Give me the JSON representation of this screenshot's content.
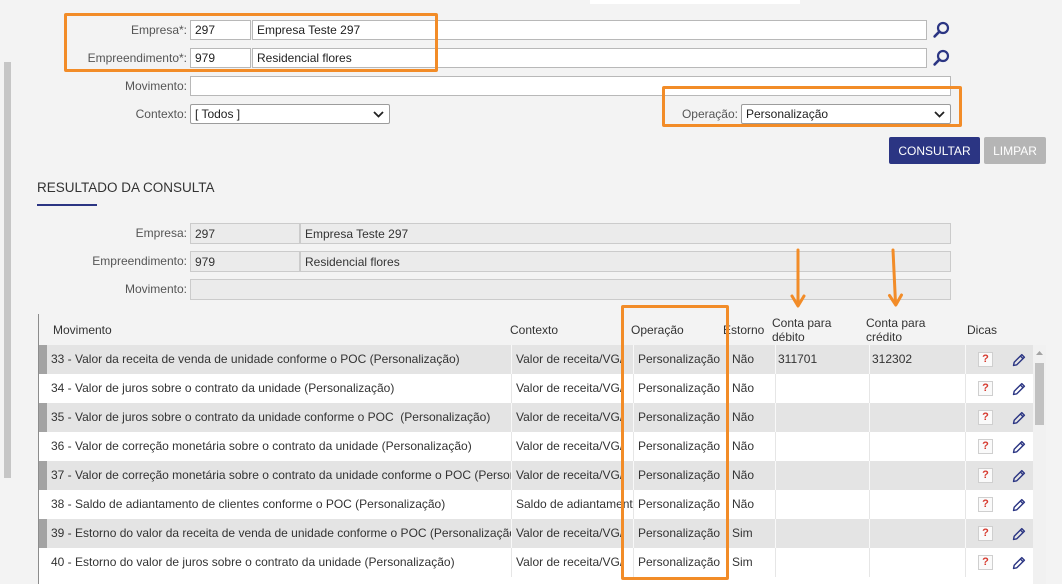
{
  "filters": {
    "empresa": {
      "label": "Empresa*:",
      "code": "297",
      "name": "Empresa Teste 297"
    },
    "empreendimento": {
      "label": "Empreendimento*:",
      "code": "979",
      "name": "Residencial flores"
    },
    "movimento": {
      "label": "Movimento:"
    },
    "contexto": {
      "label": "Contexto:",
      "selected": "[ Todos ]"
    },
    "operacao": {
      "label": "Operação:",
      "selected": "Personalização"
    }
  },
  "actions": {
    "consultar": "CONSULTAR",
    "limpar": "LIMPAR"
  },
  "result": {
    "heading": "RESULTADO DA CONSULTA",
    "empresa": {
      "label": "Empresa:",
      "code": "297",
      "name": "Empresa Teste 297"
    },
    "empreendimento": {
      "label": "Empreendimento:",
      "code": "979",
      "name": "Residencial flores"
    },
    "movimento": {
      "label": "Movimento:"
    }
  },
  "table": {
    "columns": {
      "movimento": "Movimento",
      "contexto": "Contexto",
      "operacao": "Operação",
      "estorno": "Estorno",
      "conta_debito": "Conta para débito",
      "conta_credito": "Conta para crédito",
      "dicas": "Dicas"
    },
    "help_glyph": "?",
    "rows": [
      {
        "movimento": "33 - Valor da receita de venda de unidade conforme o POC (Personalização)",
        "contexto": "Valor de receita/VG/",
        "operacao": "Personalização",
        "estorno": "Não",
        "conta_debito": "311701",
        "conta_credito": "312302"
      },
      {
        "movimento": "34 - Valor de juros sobre o contrato da unidade (Personalização)",
        "contexto": "Valor de receita/VG/",
        "operacao": "Personalização",
        "estorno": "Não"
      },
      {
        "movimento": "35 - Valor de juros sobre o contrato da unidade conforme o POC  (Personalização)",
        "contexto": "Valor de receita/VG/",
        "operacao": "Personalização",
        "estorno": "Não"
      },
      {
        "movimento": "36 - Valor de correção monetária sobre o contrato da unidade (Personalização)",
        "contexto": "Valor de receita/VG/",
        "operacao": "Personalização",
        "estorno": "Não"
      },
      {
        "movimento": "37 - Valor de correção monetária sobre o contrato da unidade conforme o POC (Persor",
        "contexto": "Valor de receita/VG/",
        "operacao": "Personalização",
        "estorno": "Não"
      },
      {
        "movimento": "38 - Saldo de adiantamento de clientes conforme o POC (Personalização)",
        "contexto": "Saldo de adiantament",
        "operacao": "Personalização",
        "estorno": "Não"
      },
      {
        "movimento": "39 - Estorno do valor da receita de venda de unidade conforme o POC (Personalização",
        "contexto": "Valor de receita/VG/",
        "operacao": "Personalização",
        "estorno": "Sim"
      },
      {
        "movimento": "40 - Estorno do valor de juros sobre o contrato da unidade (Personalização)",
        "contexto": "Valor de receita/VG/",
        "operacao": "Personalização",
        "estorno": "Sim"
      }
    ]
  },
  "icons": {
    "lookup": "search-icon",
    "select_arrow": "chevron-down-icon",
    "help": "help-icon",
    "edit": "pencil-icon",
    "scroll_up": "scroll-up-arrow-icon",
    "annotation": "arrow-down-icon"
  },
  "colors": {
    "accent": "#F28C28",
    "navy": "#2B3583",
    "clear": "#B5B5B5",
    "red": "#D63A2F",
    "stripe": "#E4E4E4"
  }
}
